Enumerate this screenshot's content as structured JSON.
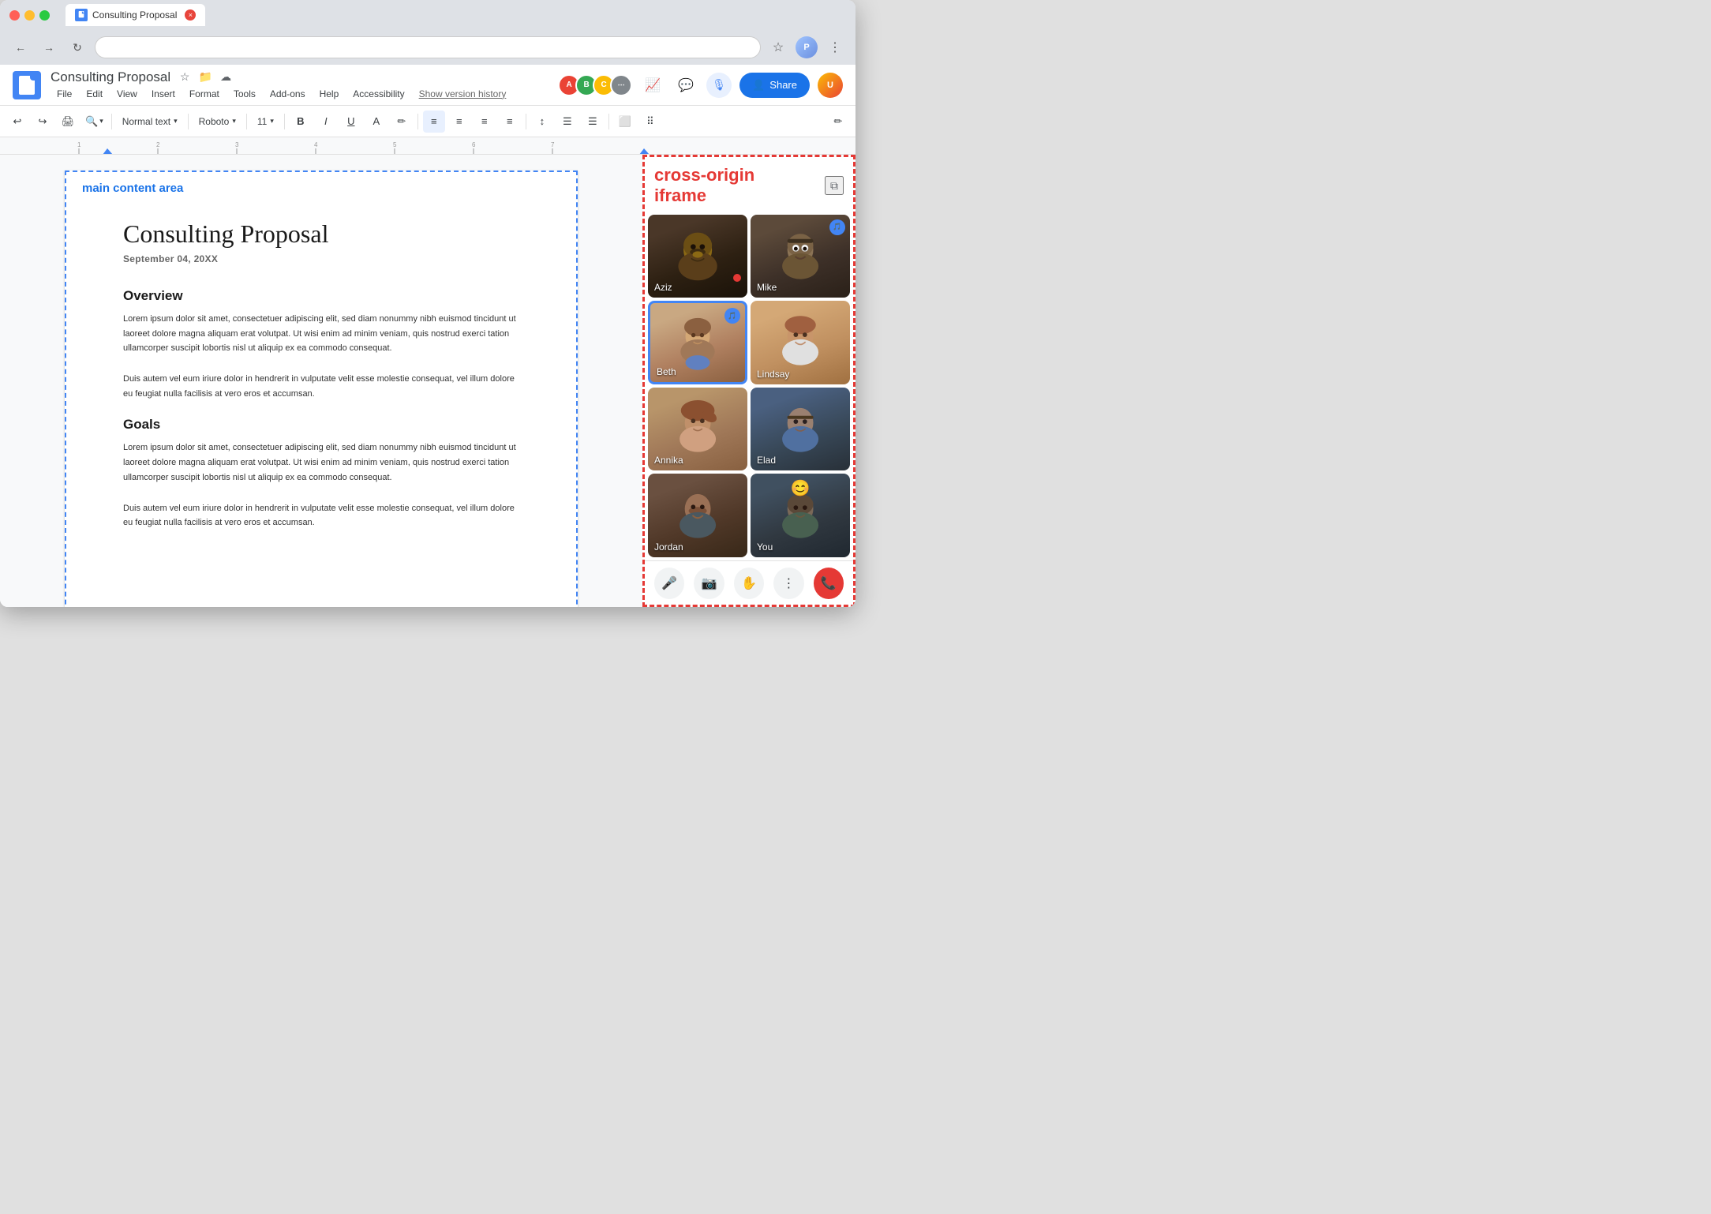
{
  "browser": {
    "tab_title": "Consulting Proposal",
    "tab_close": "×",
    "back_btn": "←",
    "forward_btn": "→",
    "refresh_btn": "↻",
    "bookmark_icon": "☆",
    "more_icon": "⋮"
  },
  "docs": {
    "logo_alt": "Google Docs",
    "filename": "Consulting Proposal",
    "star_icon": "☆",
    "menu_items": [
      "File",
      "Edit",
      "View",
      "Insert",
      "Format",
      "Tools",
      "Add-ons",
      "Help",
      "Accessibility"
    ],
    "version_history": "Show version history",
    "share_btn": "Share",
    "toolbar": {
      "undo": "↩",
      "redo": "↪",
      "print": "🖨",
      "zoom": "⌕",
      "text_style": "Normal text",
      "font": "Roboto",
      "font_size": "11",
      "bold": "B",
      "italic": "I",
      "underline": "U",
      "text_color": "A",
      "highlight": "✏",
      "align_left": "≡",
      "align_center": "≡",
      "align_right": "≡",
      "justify": "≡",
      "line_spacing": "↕",
      "bullet_list": "☰",
      "numbered_list": "☰",
      "insert_image": "⬜",
      "more_format": "⠿",
      "edit_pen": "✏"
    }
  },
  "document": {
    "main_content_label": "main content area",
    "title": "Consulting Proposal",
    "date": "September 04, 20XX",
    "sections": [
      {
        "heading": "Overview",
        "paragraphs": [
          "Lorem ipsum dolor sit amet, consectetuer adipiscing elit, sed diam nonummy nibh euismod tincidunt ut laoreet dolore magna aliquam erat volutpat. Ut wisi enim ad minim veniam, quis nostrud exerci tation ullamcorper suscipit lobortis nisl ut aliquip ex ea commodo consequat.",
          "Duis autem vel eum iriure dolor in hendrerit in vulputate velit esse molestie consequat, vel illum dolore eu feugiat nulla facilisis at vero eros et accumsan."
        ]
      },
      {
        "heading": "Goals",
        "paragraphs": [
          "Lorem ipsum dolor sit amet, consectetuer adipiscing elit, sed diam nonummy nibh euismod tincidunt ut laoreet dolore magna aliquam erat volutpat. Ut wisi enim ad minim veniam, quis nostrud exerci tation ullamcorper suscipit lobortis nisl ut aliquip ex ea commodo consequat.",
          "Duis autem vel eum iriure dolor in hendrerit in vulputate velit esse molestie consequat, vel illum dolore eu feugiat nulla facilisis at vero eros et accumsan."
        ]
      }
    ]
  },
  "side_panel": {
    "label_line1": "cross-origin",
    "label_line2": "iframe",
    "external_icon": "⧉",
    "participants": [
      {
        "name": "Aziz",
        "active": false,
        "speaking": false,
        "face_class": "face-1"
      },
      {
        "name": "Mike",
        "active": false,
        "speaking": true,
        "face_class": "face-2"
      },
      {
        "name": "Beth",
        "active": true,
        "speaking": true,
        "face_class": "face-3"
      },
      {
        "name": "Lindsay",
        "active": false,
        "speaking": false,
        "face_class": "face-4"
      },
      {
        "name": "Annika",
        "active": false,
        "speaking": false,
        "face_class": "face-5"
      },
      {
        "name": "Elad",
        "active": false,
        "speaking": false,
        "face_class": "face-6"
      },
      {
        "name": "Jordan",
        "active": false,
        "speaking": false,
        "face_class": "face-7"
      },
      {
        "name": "You",
        "active": false,
        "speaking": false,
        "has_emoji": true,
        "face_class": "face-8"
      }
    ],
    "controls": {
      "mute_icon": "🎤",
      "video_icon": "📷",
      "hand_icon": "✋",
      "more_icon": "⋮",
      "end_icon": "📞"
    }
  },
  "collab_avatars": [
    {
      "initials": "A",
      "color": "#ea4335"
    },
    {
      "initials": "B",
      "color": "#34a853"
    },
    {
      "initials": "C",
      "color": "#fbbc04"
    }
  ]
}
